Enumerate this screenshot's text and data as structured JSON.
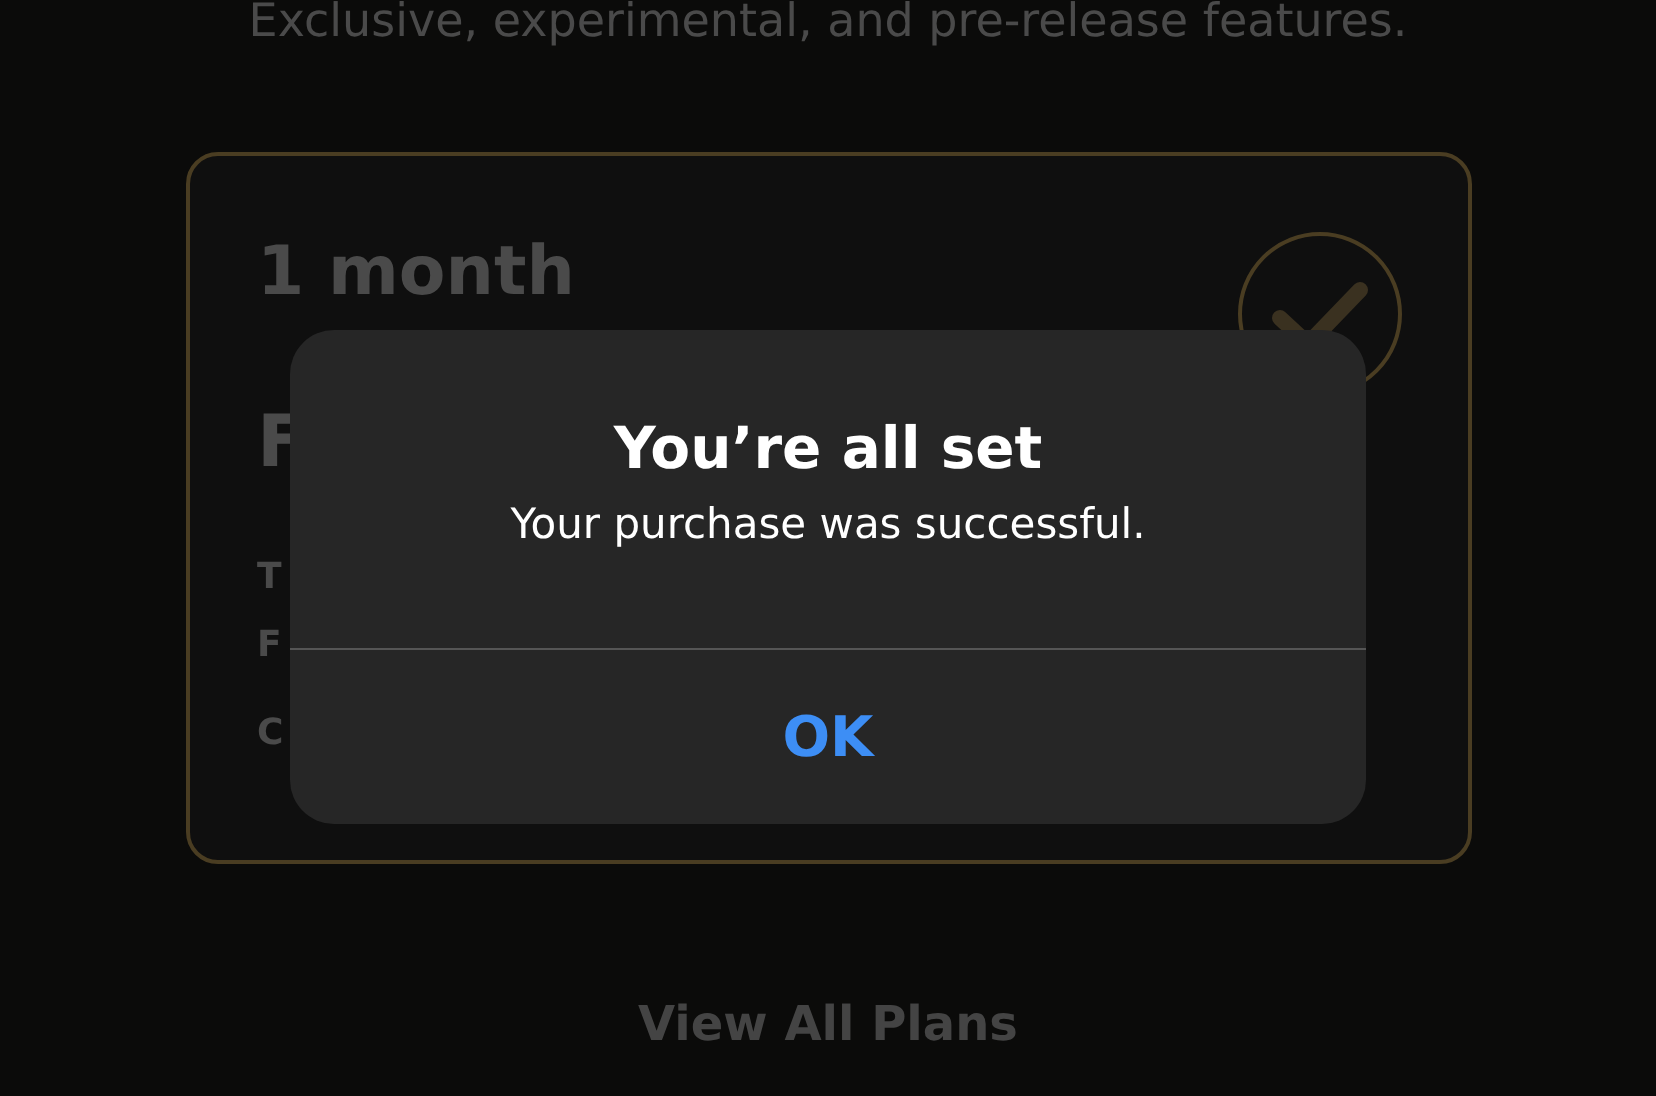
{
  "subtitle": "Exclusive, experimental, and pre-release features.",
  "plan_card": {
    "duration": "1 month",
    "selected": true,
    "price": "F",
    "description_lines": [
      "T",
      "F"
    ],
    "footnote": "C"
  },
  "alert": {
    "title": "You’re all set",
    "message": "Your purchase was successful.",
    "buttons": [
      "OK"
    ]
  },
  "link": "View All Plans"
}
